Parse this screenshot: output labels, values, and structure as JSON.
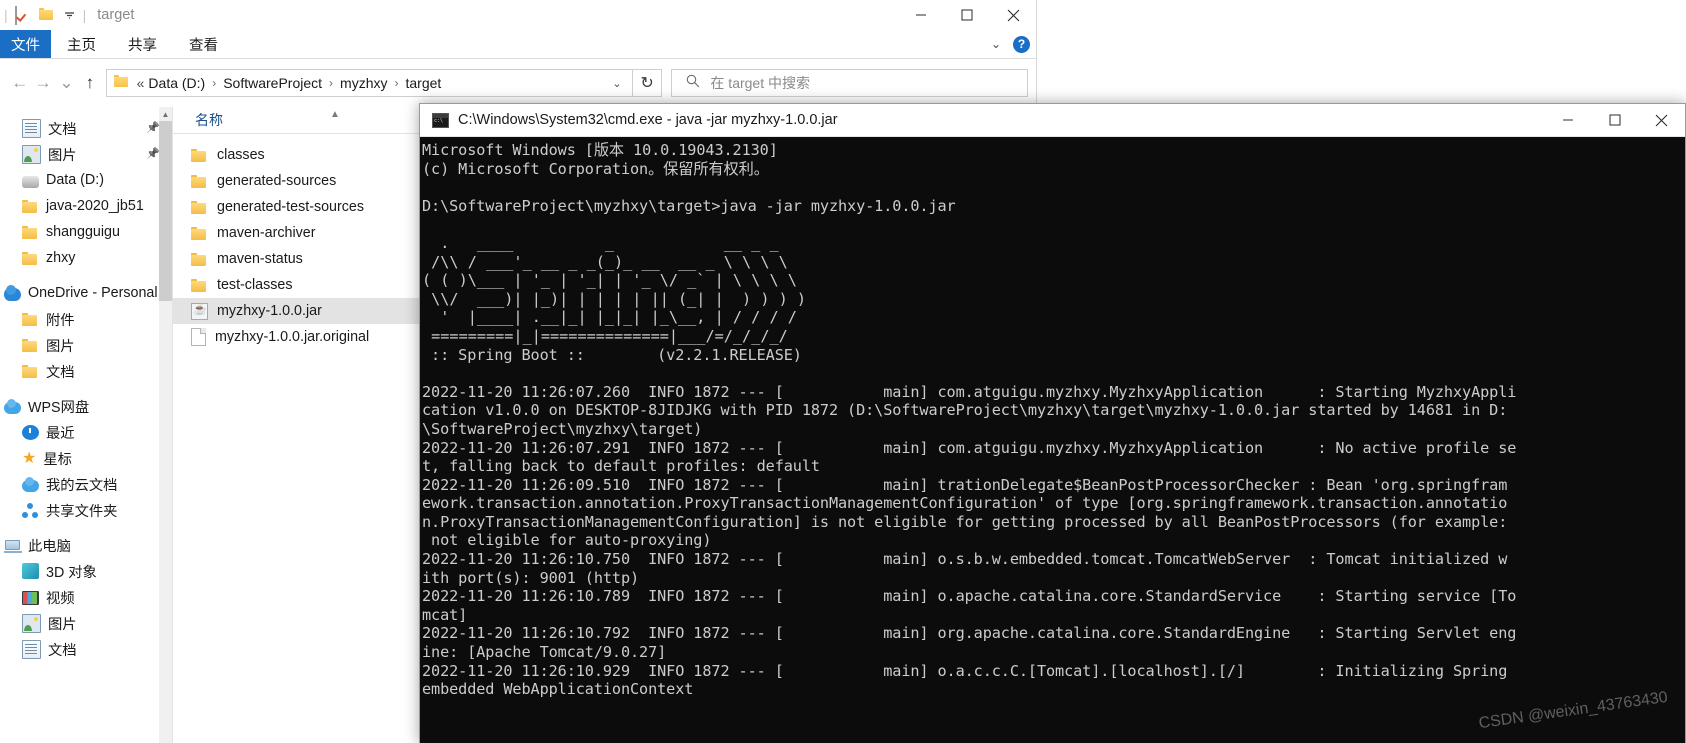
{
  "explorer": {
    "quick_access": {
      "checkbox_icon": "checkbox-checked-icon",
      "folder_icon": "folder-icon",
      "dropdown_icon": "chevron-down-icon",
      "title": "target"
    },
    "window_controls": {
      "minimize": "minimize-icon",
      "maximize": "maximize-icon",
      "close": "close-icon"
    },
    "ribbon_tabs": [
      {
        "label": "文件",
        "active": true
      },
      {
        "label": "主页",
        "active": false
      },
      {
        "label": "共享",
        "active": false
      },
      {
        "label": "查看",
        "active": false
      }
    ],
    "ribbon_right": {
      "collapse_icon": "chevron-down-icon",
      "help_label": "?"
    },
    "nav_buttons": {
      "back": "←",
      "forward": "→",
      "recent": "⌄",
      "up": "↑"
    },
    "address_bar": {
      "folder_icon": "folder-icon",
      "prefix": "«",
      "crumbs": [
        "Data (D:)",
        "SoftwareProject",
        "myzhxy",
        "target"
      ],
      "separator": "›",
      "caret_icon": "chevron-down-icon"
    },
    "refresh_button": {
      "icon": "refresh-icon",
      "label": "↻"
    },
    "search": {
      "icon": "search-icon",
      "placeholder": "在 target 中搜索"
    },
    "nav_pane": [
      {
        "label": "文档",
        "icon": "document-icon",
        "indent": 1,
        "pinned": true
      },
      {
        "label": "图片",
        "icon": "picture-icon",
        "indent": 1,
        "pinned": true
      },
      {
        "label": "Data (D:)",
        "icon": "drive-icon",
        "indent": 1,
        "pinned": false
      },
      {
        "label": "java-2020_jb51",
        "icon": "folder-icon",
        "indent": 1,
        "pinned": false
      },
      {
        "label": "shangguigu",
        "icon": "folder-icon",
        "indent": 1,
        "pinned": false
      },
      {
        "label": "zhxy",
        "icon": "folder-icon",
        "indent": 1,
        "pinned": false
      },
      {
        "label": "OneDrive - Personal",
        "icon": "onedrive-icon",
        "indent": 0,
        "pinned": false
      },
      {
        "label": "附件",
        "icon": "folder-icon",
        "indent": 1,
        "pinned": false
      },
      {
        "label": "图片",
        "icon": "folder-icon",
        "indent": 1,
        "pinned": false
      },
      {
        "label": "文档",
        "icon": "folder-icon",
        "indent": 1,
        "pinned": false
      },
      {
        "label": "WPS网盘",
        "icon": "wps-cloud-icon",
        "indent": 0,
        "pinned": false
      },
      {
        "label": "最近",
        "icon": "clock-icon",
        "indent": 1,
        "pinned": false
      },
      {
        "label": "星标",
        "icon": "star-icon",
        "indent": 1,
        "pinned": false
      },
      {
        "label": "我的云文档",
        "icon": "cloud-icon",
        "indent": 1,
        "pinned": false
      },
      {
        "label": "共享文件夹",
        "icon": "share-folder-icon",
        "indent": 1,
        "pinned": false
      },
      {
        "label": "此电脑",
        "icon": "this-pc-icon",
        "indent": 0,
        "pinned": false
      },
      {
        "label": "3D 对象",
        "icon": "3d-objects-icon",
        "indent": 1,
        "pinned": false
      },
      {
        "label": "视频",
        "icon": "video-icon",
        "indent": 1,
        "pinned": false
      },
      {
        "label": "图片",
        "icon": "picture-icon",
        "indent": 1,
        "pinned": false
      },
      {
        "label": "文档",
        "icon": "document-icon",
        "indent": 1,
        "pinned": false
      }
    ],
    "list_pane": {
      "column_header": "名称",
      "sort_arrow": "▲",
      "rows": [
        {
          "label": "classes",
          "icon": "folder-icon",
          "selected": false
        },
        {
          "label": "generated-sources",
          "icon": "folder-icon",
          "selected": false
        },
        {
          "label": "generated-test-sources",
          "icon": "folder-icon",
          "selected": false
        },
        {
          "label": "maven-archiver",
          "icon": "folder-icon",
          "selected": false
        },
        {
          "label": "maven-status",
          "icon": "folder-icon",
          "selected": false
        },
        {
          "label": "test-classes",
          "icon": "folder-icon",
          "selected": false
        },
        {
          "label": "myzhxy-1.0.0.jar",
          "icon": "jar-file-icon",
          "selected": true
        },
        {
          "label": "myzhxy-1.0.0.jar.original",
          "icon": "generic-file-icon",
          "selected": false
        }
      ]
    }
  },
  "cmd": {
    "icon": "cmd-icon",
    "title": "C:\\Windows\\System32\\cmd.exe - java  -jar myzhxy-1.0.0.jar",
    "window_controls": {
      "minimize": "minimize-icon",
      "maximize": "maximize-icon",
      "close": "close-icon"
    },
    "header_lines": "Microsoft Windows [版本 10.0.19043.2130]\n(c) Microsoft Corporation。保留所有权利。\n\nD:\\SoftwareProject\\myzhxy\\target>java -jar myzhxy-1.0.0.jar\n",
    "banner": "\n  .   ____          _            __ _ _\n /\\\\ / ___'_ __ _ _(_)_ __  __ _ \\ \\ \\ \\\n( ( )\\___ | '_ | '_| | '_ \\/ _` | \\ \\ \\ \\\n \\\\/  ___)| |_)| | | | | || (_| |  ) ) ) )\n  '  |____| .__|_| |_|_| |_\\__, | / / / /\n =========|_|==============|___/=/_/_/_/",
    "version_line": " :: Spring Boot ::        (v2.2.1.RELEASE)",
    "log_lines": "\n2022-11-20 11:26:07.260  INFO 1872 --- [           main] com.atguigu.myzhxy.MyzhxyApplication      : Starting MyzhxyAppli\ncation v1.0.0 on DESKTOP-8JIDJKG with PID 1872 (D:\\SoftwareProject\\myzhxy\\target\\myzhxy-1.0.0.jar started by 14681 in D:\n\\SoftwareProject\\myzhxy\\target)\n2022-11-20 11:26:07.291  INFO 1872 --- [           main] com.atguigu.myzhxy.MyzhxyApplication      : No active profile se\nt, falling back to default profiles: default\n2022-11-20 11:26:09.510  INFO 1872 --- [           main] trationDelegate$BeanPostProcessorChecker : Bean 'org.springfram\nework.transaction.annotation.ProxyTransactionManagementConfiguration' of type [org.springframework.transaction.annotatio\nn.ProxyTransactionManagementConfiguration] is not eligible for getting processed by all BeanPostProcessors (for example:\n not eligible for auto-proxying)\n2022-11-20 11:26:10.750  INFO 1872 --- [           main] o.s.b.w.embedded.tomcat.TomcatWebServer  : Tomcat initialized w\nith port(s): 9001 (http)\n2022-11-20 11:26:10.789  INFO 1872 --- [           main] o.apache.catalina.core.StandardService    : Starting service [To\nmcat]\n2022-11-20 11:26:10.792  INFO 1872 --- [           main] org.apache.catalina.core.StandardEngine   : Starting Servlet eng\nine: [Apache Tomcat/9.0.27]\n2022-11-20 11:26:10.929  INFO 1872 --- [           main] o.a.c.c.C.[Tomcat].[localhost].[/]        : Initializing Spring\nembedded WebApplicationContext"
  },
  "watermark": "CSDN @weixin_43763430"
}
